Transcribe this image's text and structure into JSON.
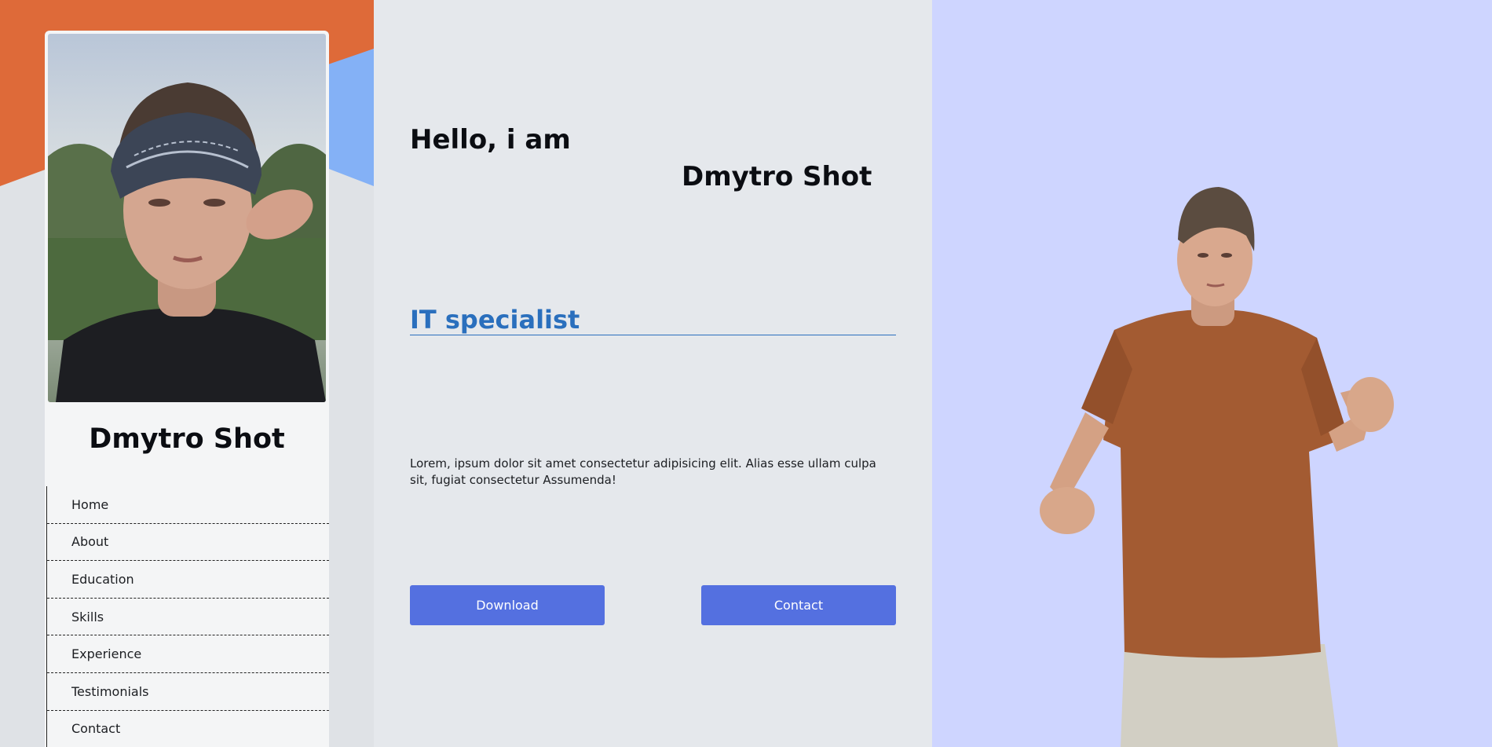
{
  "sidebar": {
    "name": "Dmytro Shot",
    "nav": [
      {
        "label": "Home"
      },
      {
        "label": "About"
      },
      {
        "label": "Education"
      },
      {
        "label": "Skills"
      },
      {
        "label": "Experience"
      },
      {
        "label": "Testimonials"
      },
      {
        "label": "Contact"
      }
    ]
  },
  "hero": {
    "greeting": "Hello, i am",
    "name": "Dmytro Shot",
    "role": "IT specialist",
    "description": "Lorem, ipsum dolor sit amet consectetur adipisicing elit. Alias esse ullam culpa sit, fugiat consectetur Assumenda!",
    "download_label": "Download",
    "contact_label": "Contact"
  },
  "colors": {
    "accent_orange": "#de6a39",
    "accent_blue": "#84b1f6",
    "role_color": "#2a6fbd",
    "button_color": "#5470e0",
    "right_bg": "#ced5ff"
  }
}
